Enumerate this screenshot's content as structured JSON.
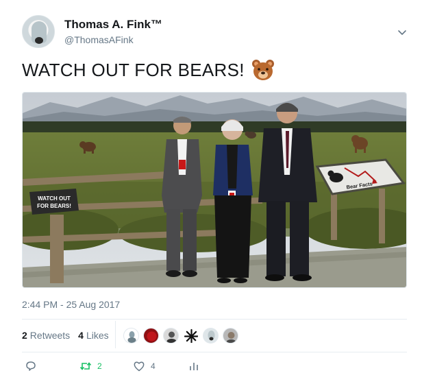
{
  "user": {
    "display_name": "Thomas A. Fink™",
    "handle": "@ThomasAFink"
  },
  "tweet": {
    "text": "WATCH OUT FOR BEARS!",
    "emoji_icon": "bear-face-icon",
    "timestamp": "2:44 PM - 25 Aug 2017"
  },
  "image": {
    "sign_left": [
      "WATCH OUT",
      "FOR BEARS!"
    ],
    "sign_right": "Bear Facts"
  },
  "stats": {
    "retweets_count": "2",
    "retweets_label": "Retweets",
    "likes_count": "4",
    "likes_label": "Likes"
  },
  "actions": {
    "reply_icon": "reply-icon",
    "retweet_icon": "retweet-icon",
    "retweet_count": "2",
    "like_icon": "heart-icon",
    "like_count": "4",
    "analytics_icon": "analytics-icon"
  },
  "colors": {
    "retweet_green": "#17bf63",
    "secondary_text": "#657786"
  }
}
